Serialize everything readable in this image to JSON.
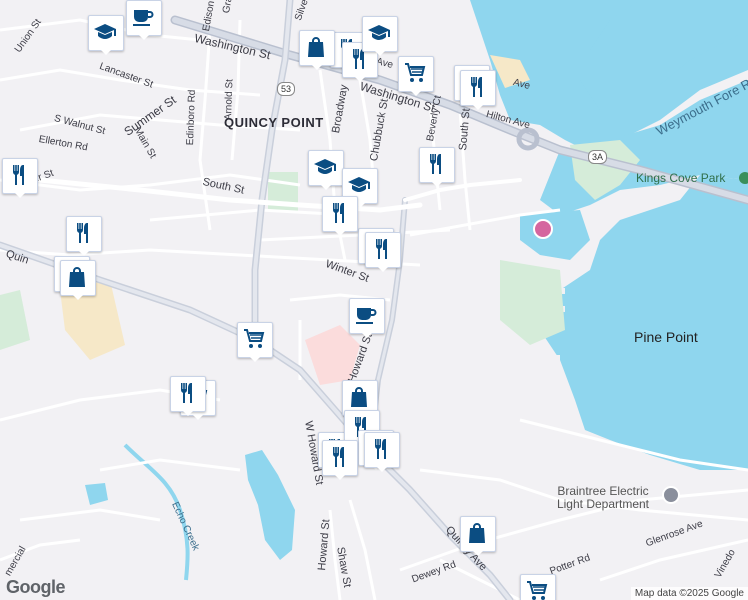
{
  "map": {
    "attribution": "Map data ©2025 Google",
    "brand": "Google",
    "area_labels": [
      {
        "text": "QUINCY POINT",
        "cls": "area"
      }
    ],
    "water_labels": [
      {
        "text": "Weymouth Fore River",
        "cls": "water"
      }
    ],
    "place_labels": [
      {
        "text": "Pine Point",
        "cls": "place"
      },
      {
        "text": "Kings Cove Park",
        "cls": "park"
      },
      {
        "text": "Braintree Electric Light Department",
        "cls": "poi"
      }
    ],
    "street_labels": [
      "Washington St",
      "Washington St",
      "South St",
      "South St",
      "Winter St",
      "Broadway",
      "Chubbuck St",
      "Edinboro Rd",
      "Arnold St",
      "Edison",
      "Graham St",
      "Silver",
      "Lancaster St",
      "Union St",
      "Summer St",
      "S Walnut St",
      "Main St",
      "Ellerton Rd",
      "Quincy Ave",
      "Quin",
      "Howard St",
      "W Howard St",
      "Shaw St",
      "Howard St",
      "Dewey Rd",
      "Potter Rd",
      "Glenrose Ave",
      "Vinedo",
      "Echo Creek",
      "Ave",
      "Hilton Ave",
      "Ave",
      "Beverly Ct",
      "Summer St",
      "mercial"
    ],
    "shields": [
      "53",
      "3A"
    ],
    "marker_icons": [
      "school",
      "restaurant",
      "restaurant",
      "shopping-bag",
      "school",
      "restaurant",
      "shopping-cart",
      "restaurant",
      "restaurant",
      "restaurant",
      "restaurant",
      "school",
      "school",
      "restaurant",
      "restaurant",
      "restaurant",
      "cafe",
      "shopping-cart",
      "shopping-bag",
      "shopping-cart",
      "cafe",
      "restaurant",
      "shopping-bag",
      "shopping-bag",
      "restaurant",
      "restaurant",
      "restaurant",
      "restaurant",
      "restaurant",
      "shopping-bag",
      "shopping-cart"
    ]
  }
}
